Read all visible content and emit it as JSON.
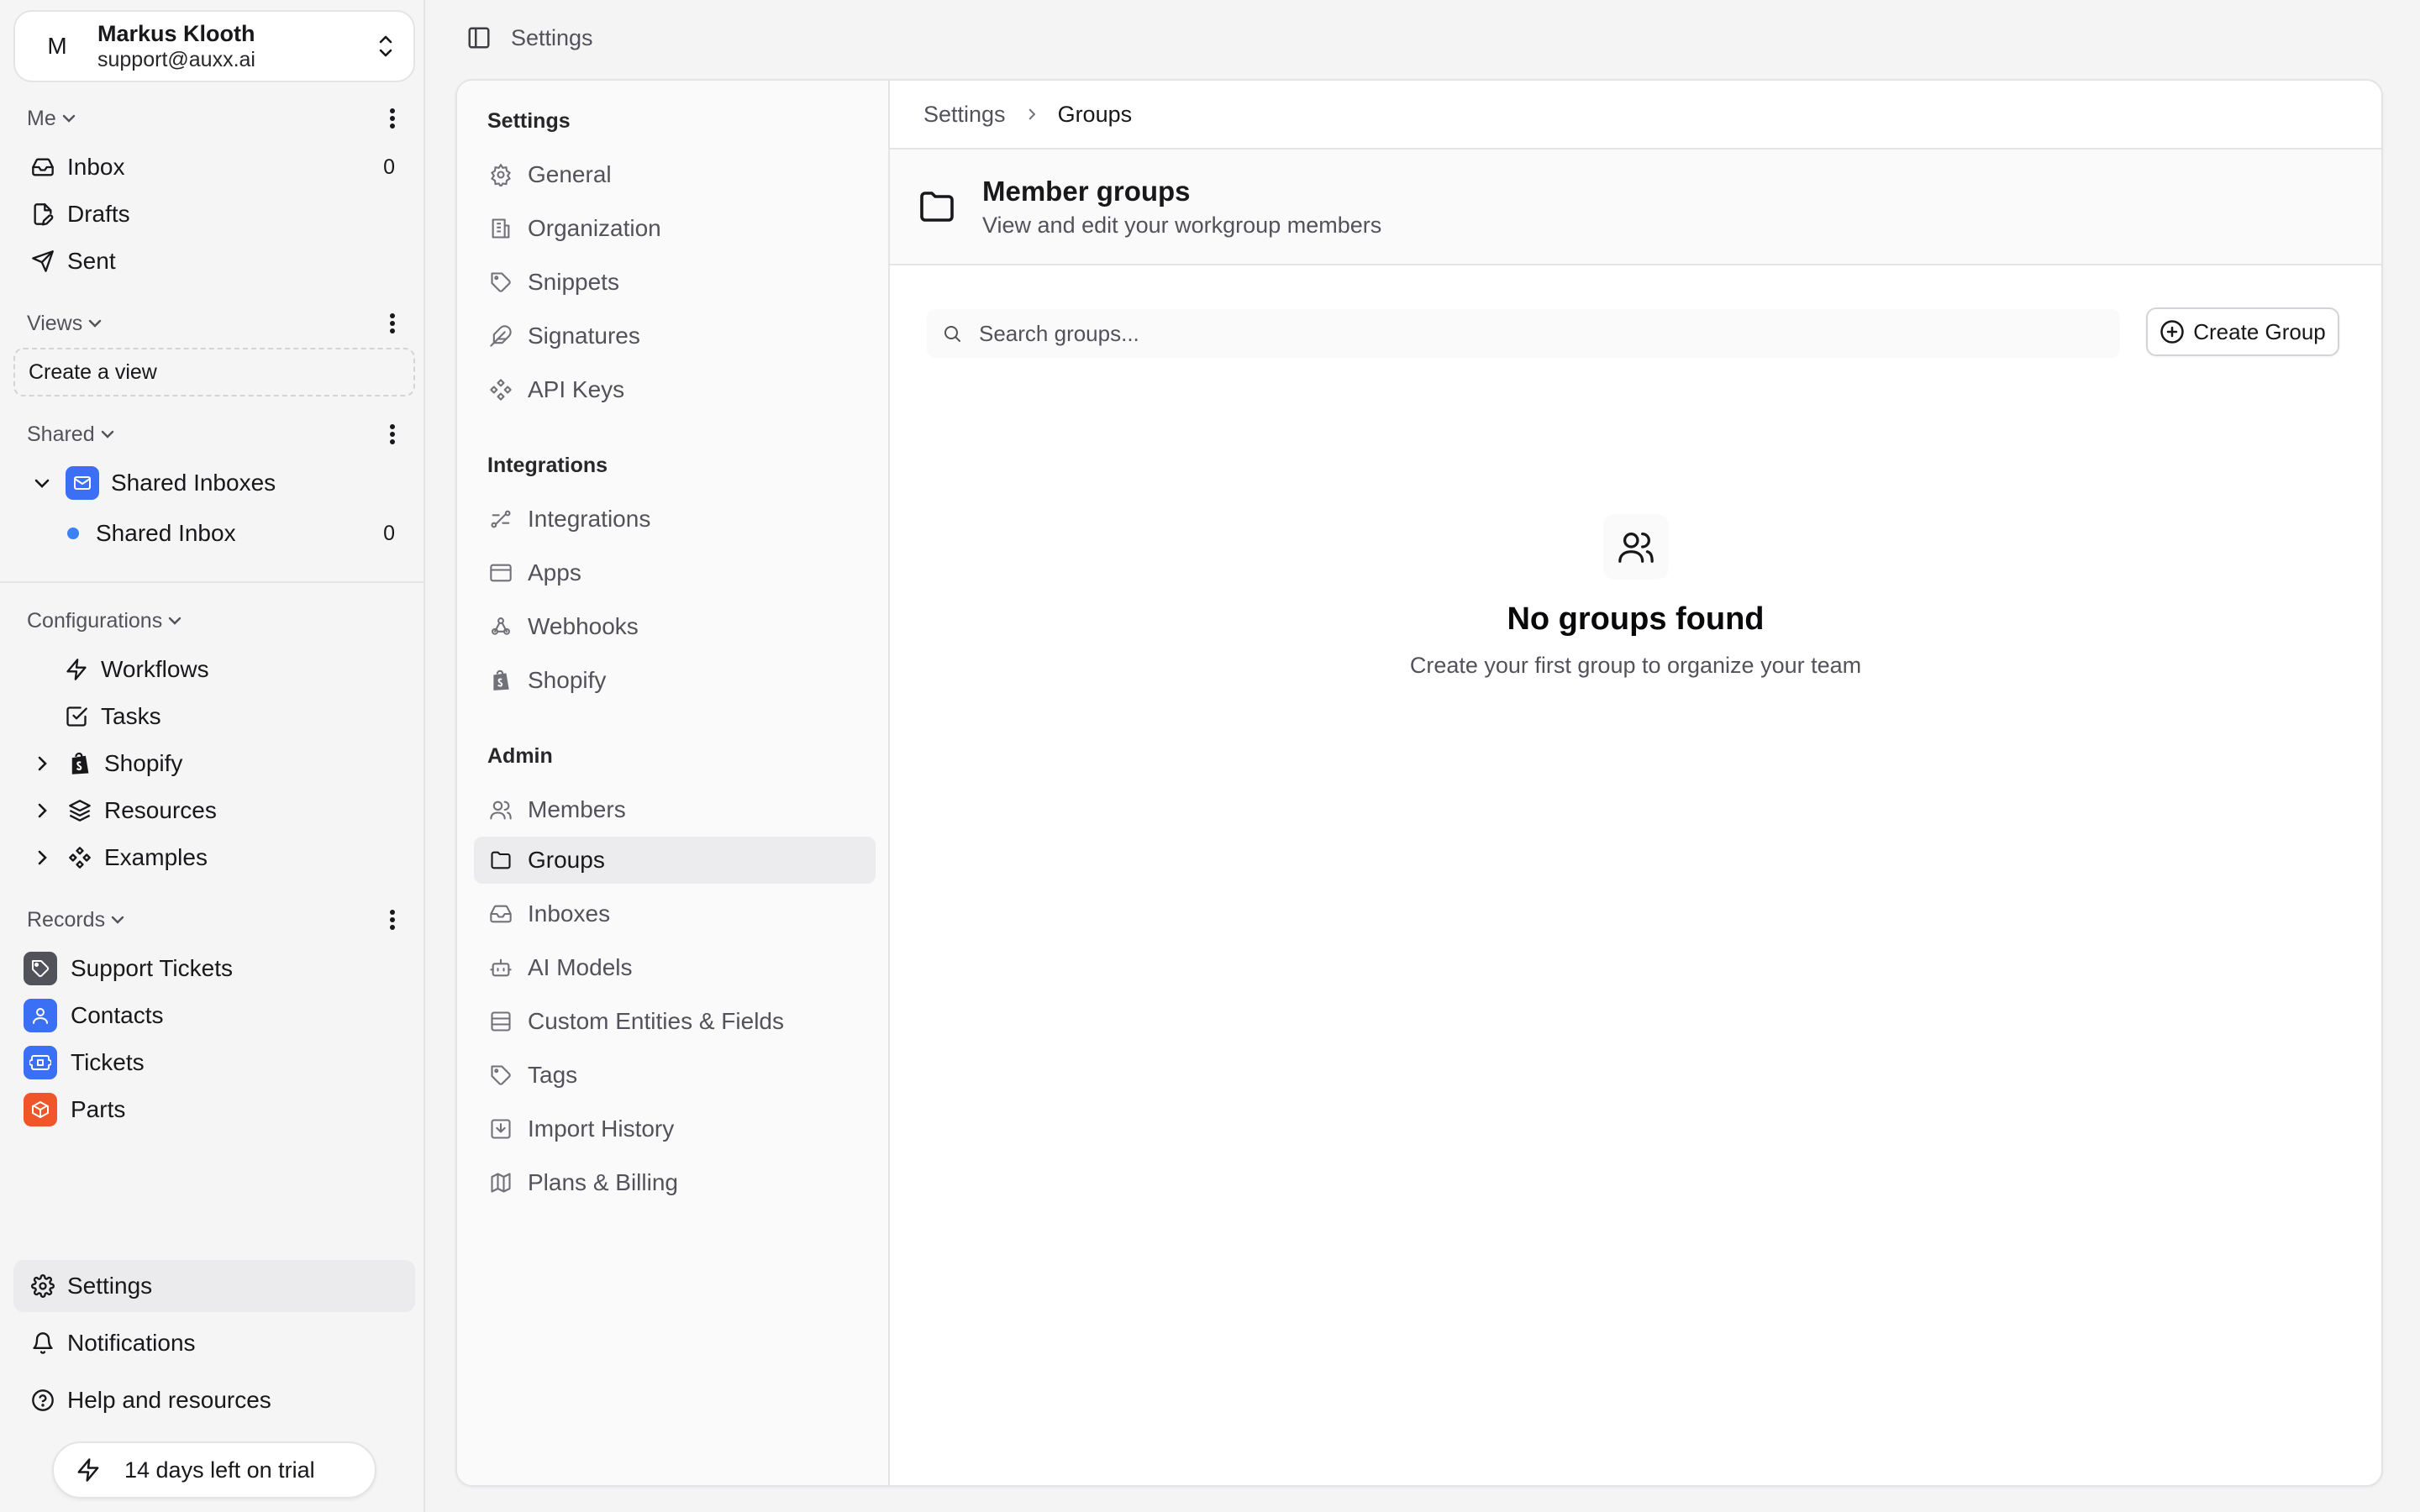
{
  "account": {
    "initial": "M",
    "name": "Markus Klooth",
    "email": "support@auxx.ai"
  },
  "sidebar": {
    "me": {
      "label": "Me",
      "items": [
        {
          "label": "Inbox",
          "count": "0"
        },
        {
          "label": "Drafts"
        },
        {
          "label": "Sent"
        }
      ]
    },
    "views": {
      "label": "Views",
      "create_label": "Create a view"
    },
    "shared": {
      "label": "Shared",
      "group_label": "Shared Inboxes",
      "inbox_label": "Shared Inbox",
      "inbox_count": "0"
    },
    "configurations": {
      "label": "Configurations",
      "items": [
        "Workflows",
        "Tasks",
        "Shopify",
        "Resources",
        "Examples"
      ]
    },
    "records": {
      "label": "Records",
      "items": [
        "Support Tickets",
        "Contacts",
        "Tickets",
        "Parts"
      ]
    },
    "footer": {
      "settings": "Settings",
      "notifications": "Notifications",
      "help": "Help and resources"
    },
    "trial": "14 days left on trial"
  },
  "topbar": {
    "title": "Settings"
  },
  "settings_nav": {
    "settings_group": "Settings",
    "settings_items": [
      "General",
      "Organization",
      "Snippets",
      "Signatures",
      "API Keys"
    ],
    "integrations_group": "Integrations",
    "integrations_items": [
      "Integrations",
      "Apps",
      "Webhooks",
      "Shopify"
    ],
    "admin_group": "Admin",
    "admin_items": [
      "Members",
      "Groups",
      "Inboxes",
      "AI Models",
      "Custom Entities & Fields",
      "Tags",
      "Import History",
      "Plans & Billing"
    ],
    "active": "Groups"
  },
  "breadcrumb": {
    "parent": "Settings",
    "current": "Groups"
  },
  "page": {
    "title": "Member groups",
    "subtitle": "View and edit your workgroup members"
  },
  "search": {
    "placeholder": "Search groups...",
    "value": ""
  },
  "create_button": "Create Group",
  "empty_state": {
    "title": "No groups found",
    "subtitle": "Create your first group to organize your team"
  },
  "colors": {
    "accent_blue": "#3b6ff5",
    "record_gray": "#52525b",
    "record_orange": "#f0562a",
    "dot_blue": "#3b82f6"
  }
}
